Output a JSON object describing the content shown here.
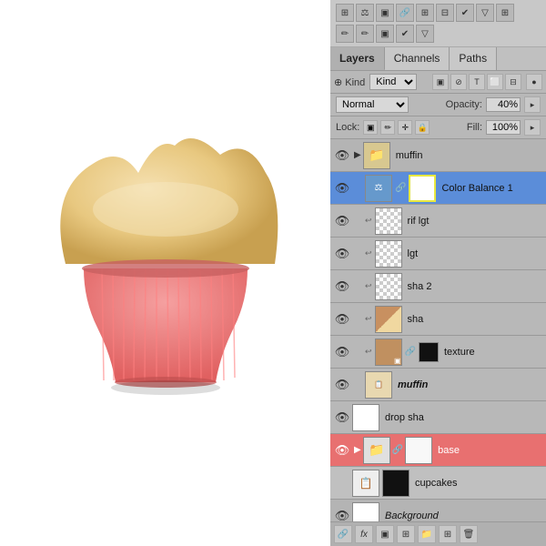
{
  "toolbar": {
    "tools": [
      "⊞",
      "⚖",
      "▣",
      "🔗",
      "⊞",
      "⊟",
      "✔",
      "▽",
      "⊞"
    ]
  },
  "tabs": {
    "layers": "Layers",
    "channels": "Channels",
    "paths": "Paths",
    "active": "layers"
  },
  "filter": {
    "label": "⊕ Kind",
    "icons": [
      "▣",
      "⊘",
      "T",
      "⊞",
      "⊟"
    ]
  },
  "blend": {
    "mode": "Normal",
    "opacity_label": "Opacity:",
    "opacity_value": "40%"
  },
  "lock": {
    "label": "Lock:",
    "icons": [
      "▣",
      "✏",
      "✛",
      "🔒"
    ],
    "fill_label": "Fill:",
    "fill_value": "100%"
  },
  "layers": [
    {
      "id": "group-muffin",
      "type": "group",
      "visible": true,
      "name": "muffin",
      "active": false,
      "indent": 0
    },
    {
      "id": "color-balance-1",
      "type": "adjustment",
      "visible": true,
      "name": "Color Balance 1",
      "active": true,
      "indent": 1,
      "has_chain": true,
      "thumb_type": "color-bal"
    },
    {
      "id": "rif-lgt",
      "type": "layer",
      "visible": true,
      "name": "rif lgt",
      "active": false,
      "indent": 1,
      "thumb_type": "checkered"
    },
    {
      "id": "lgt",
      "type": "layer",
      "visible": true,
      "name": "lgt",
      "active": false,
      "indent": 1,
      "thumb_type": "checkered"
    },
    {
      "id": "sha-2",
      "type": "layer",
      "visible": true,
      "name": "sha 2",
      "active": false,
      "indent": 1,
      "thumb_type": "checkered"
    },
    {
      "id": "sha",
      "type": "layer",
      "visible": true,
      "name": "sha",
      "active": false,
      "indent": 1,
      "thumb_type": "checkered-brown"
    },
    {
      "id": "texture",
      "type": "layer-chain",
      "visible": true,
      "name": "texture",
      "active": false,
      "indent": 1,
      "has_chain": true,
      "thumb_type": "brown-white"
    },
    {
      "id": "muffin-layer",
      "type": "smart",
      "visible": true,
      "name": "muffin",
      "active": false,
      "indent": 1,
      "thumb_type": "muffin-icon"
    },
    {
      "id": "drop-sha",
      "type": "layer",
      "visible": true,
      "name": "drop sha",
      "active": false,
      "indent": 0,
      "thumb_type": "white-bg"
    },
    {
      "id": "base",
      "type": "group",
      "visible": true,
      "name": "base",
      "active": false,
      "indent": 0,
      "is_red": true
    },
    {
      "id": "cupcakes",
      "type": "layer",
      "visible": false,
      "name": "cupcakes",
      "active": false,
      "indent": 0,
      "thumb_type": "black-square"
    },
    {
      "id": "background",
      "type": "layer",
      "visible": true,
      "name": "Background",
      "active": false,
      "indent": 0,
      "thumb_type": "white-bg",
      "italic": true
    }
  ],
  "bottom_bar": {
    "icons": [
      "🔗",
      "fx",
      "▣",
      "⊞",
      "🗑"
    ]
  }
}
